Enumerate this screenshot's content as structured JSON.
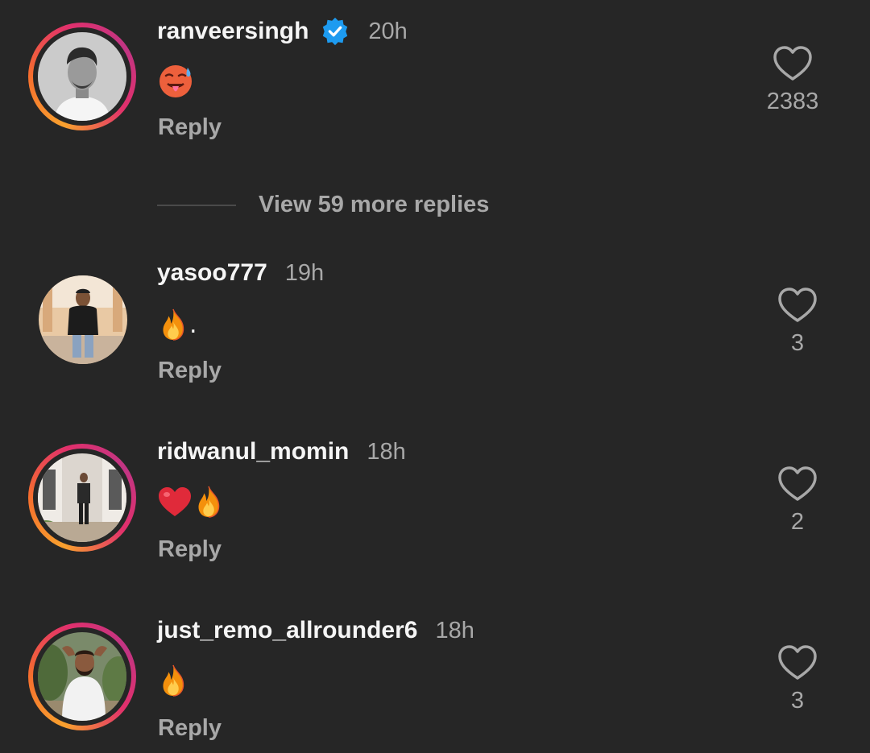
{
  "accent": {
    "verified": "#1d9bf0",
    "ring_start": "#f9a12e",
    "ring_end": "#c13584",
    "background": "#262626",
    "secondary_text": "#a8a8a8"
  },
  "comments": [
    {
      "username": "ranveersingh",
      "verified": true,
      "time": "20h",
      "body": "",
      "body_icons": [
        "hot-face-emoji"
      ],
      "reply_label": "Reply",
      "likes": "2383",
      "story_ring": true
    },
    {
      "username": "yasoo777",
      "verified": false,
      "time": "19h",
      "body": ".",
      "body_icons": [
        "fire-emoji"
      ],
      "reply_label": "Reply",
      "likes": "3",
      "story_ring": false
    },
    {
      "username": "ridwanul_momin",
      "verified": false,
      "time": "18h",
      "body": "",
      "body_icons": [
        "red-heart-emoji",
        "fire-emoji"
      ],
      "reply_label": "Reply",
      "likes": "2",
      "story_ring": true
    },
    {
      "username": "just_remo_allrounder6",
      "verified": false,
      "time": "18h",
      "body": "",
      "body_icons": [
        "fire-emoji"
      ],
      "reply_label": "Reply",
      "likes": "3",
      "story_ring": true
    }
  ],
  "view_more_replies": "View 59 more replies"
}
